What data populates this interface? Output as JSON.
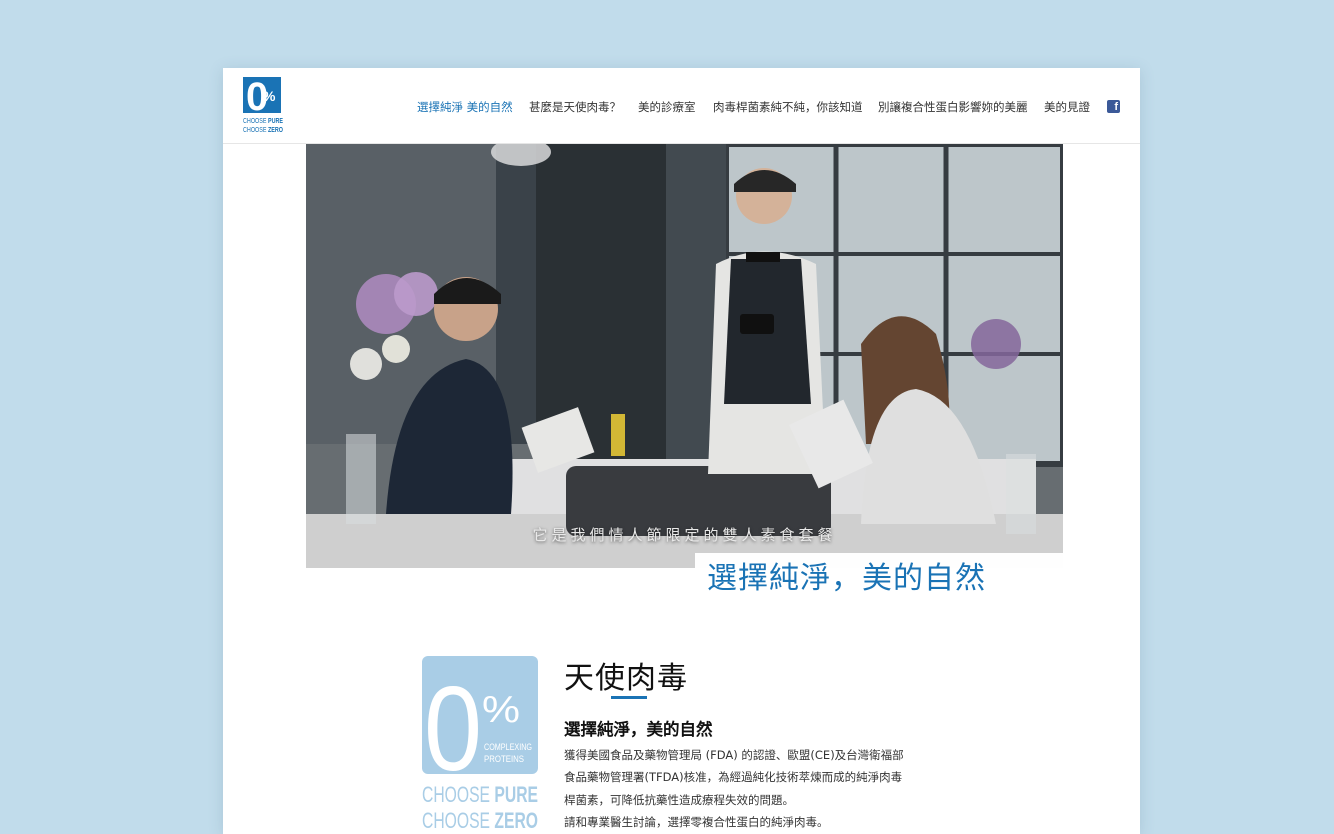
{
  "nav": {
    "items": [
      {
        "label": "選擇純淨 美的自然",
        "active": true
      },
      {
        "label": "甚麼是天使肉毒？",
        "active": false
      },
      {
        "label": "美的診療室",
        "active": false
      },
      {
        "label": "肉毒桿菌素純不純，你該知道",
        "active": false
      },
      {
        "label": "別讓複合性蛋白影響妳的美麗",
        "active": false
      },
      {
        "label": "美的見證",
        "active": false
      }
    ],
    "facebook_icon": "f"
  },
  "logo": {
    "zero": "0",
    "percent": "%",
    "small_caption_1": "COMPLEXING",
    "small_caption_2": "PROTEINS",
    "line1_a": "CHOOSE",
    "line1_b": "PURE",
    "line2_a": "CHOOSE",
    "line2_b": "ZERO"
  },
  "hero": {
    "subtitle": "它是我們情人節限定的雙人素食套餐",
    "banner": "選擇純淨，美的自然"
  },
  "content": {
    "heading": "天使肉毒",
    "sub_heading": "選擇純淨，美的自然",
    "paragraph_lines": [
      "獲得美國食品及藥物管理局 (FDA) 的認證、歐盟(CE)及台灣衛福部",
      "食品藥物管理署(TFDA)核准，為經過純化技術萃煉而成的純淨肉毒",
      "桿菌素，可降低抗藥性造成療程失效的問題。",
      "請和專業醫生討論，選擇零複合性蛋白的純淨肉毒。"
    ]
  },
  "colors": {
    "brand_blue": "#1a73b5",
    "logo_light_blue": "#a9cde6",
    "page_background": "#c1dceb"
  }
}
